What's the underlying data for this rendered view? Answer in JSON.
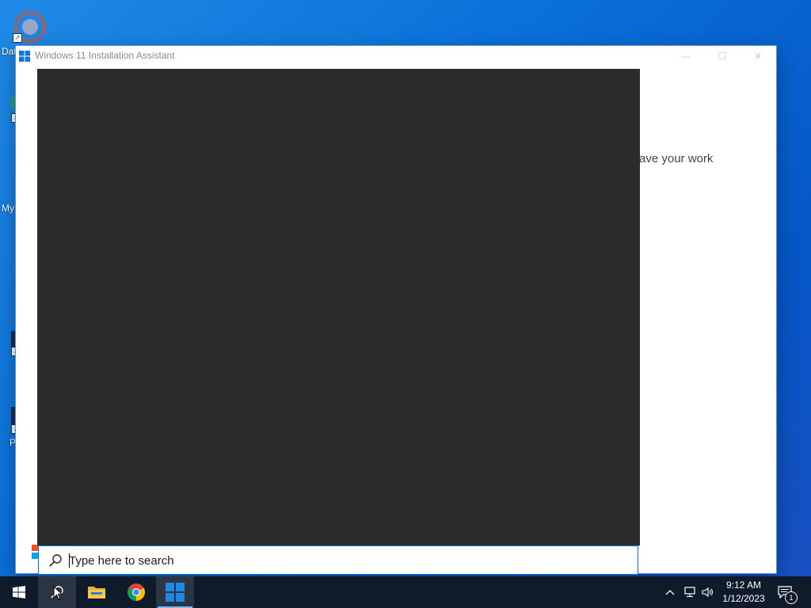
{
  "desktop": {
    "icons": [
      {
        "label": "Dat",
        "name": "desktop-icon-dat"
      },
      {
        "label": "",
        "name": "desktop-icon-2"
      },
      {
        "label": "My",
        "name": "desktop-icon-my"
      },
      {
        "label": "",
        "name": "desktop-icon-4"
      },
      {
        "label": "P",
        "name": "desktop-icon-p"
      }
    ]
  },
  "window": {
    "title": "Windows 11 Installation Assistant",
    "partial_text": "ave your work",
    "controls": {
      "minimize": "—",
      "maximize": "☐",
      "close": "✕"
    }
  },
  "search": {
    "placeholder": "Type here to search",
    "value": ""
  },
  "taskbar": {
    "apps": [
      {
        "name": "start-button",
        "icon": "windows-logo-icon"
      },
      {
        "name": "search-button",
        "icon": "search-icon"
      },
      {
        "name": "file-explorer-button",
        "icon": "folder-icon"
      },
      {
        "name": "chrome-button",
        "icon": "chrome-icon"
      },
      {
        "name": "installation-assistant-button",
        "icon": "windows11-logo-icon"
      }
    ],
    "tray": {
      "chevron": "^",
      "time": "9:12 AM",
      "date": "1/12/2023",
      "notification_count": "1"
    }
  },
  "colors": {
    "desktop_blue": "#0a6fd8",
    "taskbar": "#0f1a2a",
    "panel_dark": "#2b2b2b",
    "accent": "#0078d7"
  }
}
